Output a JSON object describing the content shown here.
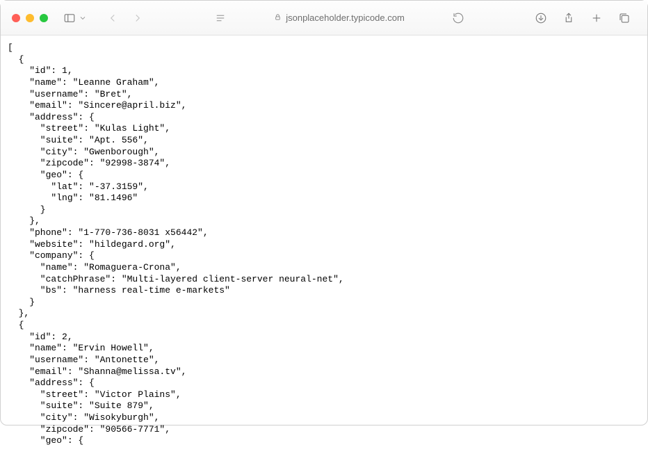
{
  "address": {
    "host": "jsonplaceholder.typicode.com"
  },
  "content": {
    "json_text": "[\n  {\n    \"id\": 1,\n    \"name\": \"Leanne Graham\",\n    \"username\": \"Bret\",\n    \"email\": \"Sincere@april.biz\",\n    \"address\": {\n      \"street\": \"Kulas Light\",\n      \"suite\": \"Apt. 556\",\n      \"city\": \"Gwenborough\",\n      \"zipcode\": \"92998-3874\",\n      \"geo\": {\n        \"lat\": \"-37.3159\",\n        \"lng\": \"81.1496\"\n      }\n    },\n    \"phone\": \"1-770-736-8031 x56442\",\n    \"website\": \"hildegard.org\",\n    \"company\": {\n      \"name\": \"Romaguera-Crona\",\n      \"catchPhrase\": \"Multi-layered client-server neural-net\",\n      \"bs\": \"harness real-time e-markets\"\n    }\n  },\n  {\n    \"id\": 2,\n    \"name\": \"Ervin Howell\",\n    \"username\": \"Antonette\",\n    \"email\": \"Shanna@melissa.tv\",\n    \"address\": {\n      \"street\": \"Victor Plains\",\n      \"suite\": \"Suite 879\",\n      \"city\": \"Wisokyburgh\",\n      \"zipcode\": \"90566-7771\",\n      \"geo\": {"
  },
  "icons": {
    "close": "close-icon",
    "minimize": "minimize-icon",
    "fullscreen": "fullscreen-icon",
    "sidebar": "sidebar-icon",
    "dropdown": "chevron-down-icon",
    "back": "back-icon",
    "forward": "forward-icon",
    "reader": "reader-icon",
    "lock": "lock-icon",
    "reload": "reload-icon",
    "downloads": "downloads-icon",
    "share": "share-icon",
    "newtab": "plus-icon",
    "tabs": "tabs-icon"
  }
}
